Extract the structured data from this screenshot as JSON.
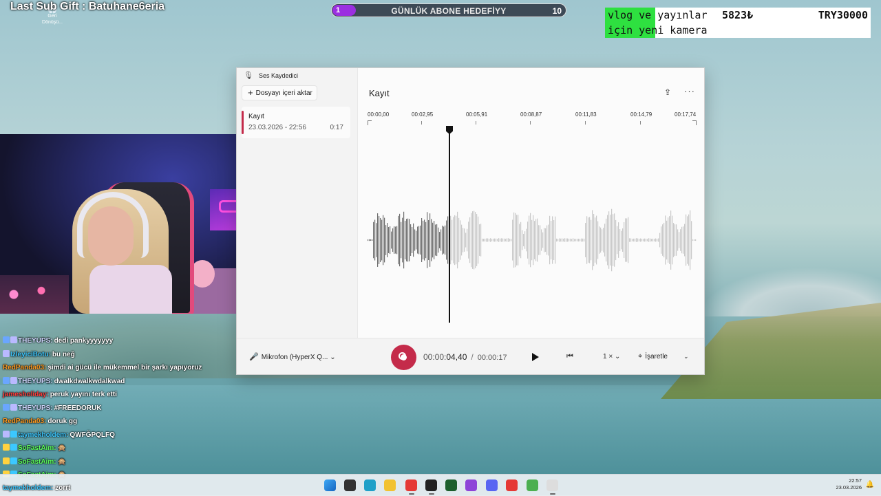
{
  "overlay": {
    "last_sub": "Last Sub Gift : Batuhane6eria",
    "goal": {
      "current": "1",
      "title": "GÜNLÜK ABONE HEDEFİYY",
      "target": "10",
      "progress": 0.1
    },
    "donation": {
      "line1": "vlog ve yayınlar",
      "line2": "için yeni kamera",
      "amount": "5823₺",
      "target": "TRY30000",
      "progress": 0.19
    }
  },
  "desktop": {
    "recycle_bin_label": "Geri Dönüşü..."
  },
  "chat": [
    {
      "user": "THEYUPS:",
      "text": "dedi pankyyyyyyy",
      "color": "#d0d8ff",
      "badges": [
        "#6aa6ff",
        "#b9b9ff"
      ]
    },
    {
      "user": "IzleyiciBotu:",
      "text": "bu neğ",
      "color": "#3cc8ff",
      "badges": [
        "#b9b9ff"
      ]
    },
    {
      "user": "RedPanda03:",
      "text": "şimdi ai gücü ile mükemmel bir şarkı yapıyoruz",
      "color": "#ff9a1f",
      "badges": []
    },
    {
      "user": "THEYUPS:",
      "text": "dwalkdwalkwdalkwad",
      "color": "#d0d8ff",
      "badges": [
        "#6aa6ff",
        "#b9b9ff"
      ]
    },
    {
      "user": "jamesholiday:",
      "text": "peruk yayını terk etti",
      "color": "#ff3b3b",
      "badges": []
    },
    {
      "user": "THEYUPS:",
      "text": "#FREEDORUK",
      "color": "#d0d8ff",
      "badges": [
        "#6aa6ff",
        "#b9b9ff"
      ]
    },
    {
      "user": "RedPanda03:",
      "text": "doruk gg",
      "color": "#ff9a1f",
      "badges": []
    },
    {
      "user": "taymekholdem:",
      "text": "QWFĞPQLFQ",
      "color": "#3cc8ff",
      "badges": [
        "#b9b9ff",
        "#3cc8ff"
      ]
    },
    {
      "user": "SoFastAim:",
      "text": "🙊",
      "color": "#5cff5c",
      "badges": [
        "#ffd23f",
        "#3cc8ff"
      ]
    },
    {
      "user": "SoFastAim:",
      "text": "🙊",
      "color": "#5cff5c",
      "badges": [
        "#ffd23f",
        "#3cc8ff"
      ]
    },
    {
      "user": "SoFastAim:",
      "text": "🙊",
      "color": "#5cff5c",
      "badges": [
        "#ffd23f",
        "#3cc8ff"
      ]
    }
  ],
  "taskbar_chat": {
    "user": "taymekholdem:",
    "text": "zorrt"
  },
  "recorder": {
    "window_title": "Ses Kaydedici",
    "import_label": "Dosyayı içeri aktar",
    "recording": {
      "name": "Kayıt",
      "date": "23.03.2026 - 22:56",
      "duration": "0:17"
    },
    "page_title": "Kayıt",
    "timeline_ticks": [
      "00:00,00",
      "00:02,95",
      "00:05,91",
      "00:08,87",
      "00:11,83",
      "00:14,79",
      "00:17,74"
    ],
    "mic_label": "Mikrofon (HyperX Q...",
    "time": {
      "dim_part": "00:00:",
      "current": "04,40",
      "separator": "/",
      "total": "00:00:17"
    },
    "speed": "1 ×",
    "mark_label": "İşaretle",
    "accent": "#c42b4a"
  },
  "clock": {
    "time": "22:57",
    "date": "23.03.2026"
  },
  "taskbar_icons": [
    "windows-start-icon",
    "file-manager-icon",
    "edge-browser-icon",
    "folder-icon",
    "chrome-icon",
    "obs-icon",
    "terminal-icon",
    "twitch-icon",
    "discord-icon",
    "chrome-profile-icon",
    "chrome-profile-2-icon",
    "voice-recorder-icon"
  ]
}
